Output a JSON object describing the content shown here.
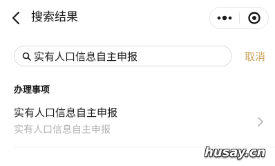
{
  "header": {
    "back_icon": "chevron-left-icon",
    "title": "搜索结果",
    "capsule": {
      "more_icon": "more-dots-icon",
      "close_icon": "target-close-icon"
    }
  },
  "search": {
    "value": "实有人口信息自主申报",
    "icon": "search-icon",
    "cancel_label": "取消"
  },
  "section": {
    "title": "办理事项"
  },
  "results": [
    {
      "title": "实有人口信息自主申报",
      "subtitle": "实有人口信息自主申报",
      "icon": "chevron-right-icon"
    }
  ],
  "watermark": {
    "text": "husay.cn"
  },
  "colors": {
    "accent": "#c9a35c",
    "text": "#1a1a1a",
    "muted": "#b2b2b2",
    "border": "#dcdcdc"
  }
}
